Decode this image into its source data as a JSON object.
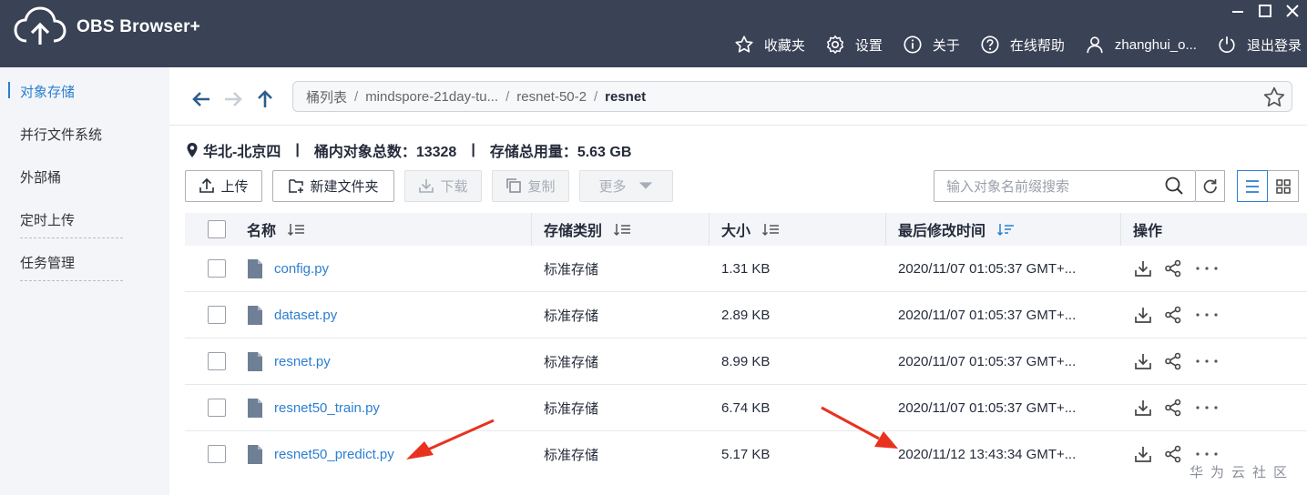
{
  "app": {
    "title": "OBS Browser+"
  },
  "window_controls": [
    "minimize",
    "maximize",
    "close"
  ],
  "topnav": [
    {
      "icon": "star-icon",
      "label": "收藏夹"
    },
    {
      "icon": "gear-icon",
      "label": "设置"
    },
    {
      "icon": "info-icon",
      "label": "关于"
    },
    {
      "icon": "help-icon",
      "label": "在线帮助"
    },
    {
      "icon": "user-icon",
      "label": "zhanghui_o..."
    },
    {
      "icon": "power-icon",
      "label": "退出登录"
    }
  ],
  "sidebar": {
    "items": [
      {
        "label": "对象存储",
        "active": true
      },
      {
        "label": "并行文件系统",
        "active": false
      },
      {
        "label": "外部桶",
        "active": false
      },
      {
        "label": "定时上传",
        "active": false
      },
      {
        "label": "任务管理",
        "active": false
      }
    ]
  },
  "breadcrumb": {
    "items": [
      "桶列表",
      "mindspore-21day-tu...",
      "resnet-50-2"
    ],
    "current": "resnet",
    "separator": "/"
  },
  "info": {
    "region": "华北-北京四",
    "object_count_label": "桶内对象总数：13328",
    "storage_label": "存储总用量：5.63 GB",
    "separator": "|"
  },
  "toolbar": {
    "upload": "上传",
    "new_folder": "新建文件夹",
    "download": "下载",
    "copy": "复制",
    "more": "更多"
  },
  "search": {
    "placeholder": "输入对象名前缀搜索"
  },
  "table": {
    "columns": [
      "名称",
      "存储类别",
      "大小",
      "最后修改时间",
      "操作"
    ],
    "rows": [
      {
        "name": "config.py",
        "storage_class": "标准存储",
        "size": "1.31 KB",
        "modified": "2020/11/07 01:05:37 GMT+..."
      },
      {
        "name": "dataset.py",
        "storage_class": "标准存储",
        "size": "2.89 KB",
        "modified": "2020/11/07 01:05:37 GMT+..."
      },
      {
        "name": "resnet.py",
        "storage_class": "标准存储",
        "size": "8.99 KB",
        "modified": "2020/11/07 01:05:37 GMT+..."
      },
      {
        "name": "resnet50_train.py",
        "storage_class": "标准存储",
        "size": "6.74 KB",
        "modified": "2020/11/07 01:05:37 GMT+..."
      },
      {
        "name": "resnet50_predict.py",
        "storage_class": "标准存储",
        "size": "5.17 KB",
        "modified": "2020/11/12 13:43:34 GMT+..."
      }
    ],
    "actions": [
      "download-icon",
      "share-icon",
      "more-icon"
    ]
  },
  "watermark": "华为云社区",
  "colors": {
    "header": "#3a4256",
    "accent": "#2b7fd1",
    "annotation": "#e8321f"
  }
}
